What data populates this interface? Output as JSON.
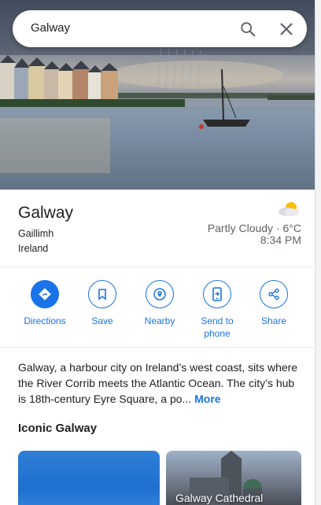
{
  "search": {
    "query": "Galway"
  },
  "place": {
    "name": "Galway",
    "irish_name": "Gaillimh",
    "country": "Ireland"
  },
  "weather": {
    "condition": "Partly Cloudy · 6°C",
    "time": "8:34 PM",
    "icon": "partly-cloudy-icon"
  },
  "actions": [
    {
      "label": "Directions",
      "icon": "directions-icon"
    },
    {
      "label": "Save",
      "icon": "bookmark-icon"
    },
    {
      "label": "Nearby",
      "icon": "nearby-icon"
    },
    {
      "label": "Send to phone",
      "icon": "send-to-phone-icon"
    },
    {
      "label": "Share",
      "icon": "share-icon"
    }
  ],
  "description": {
    "text": "Galway, a harbour city on Ireland’s west coast, sits where the River Corrib meets the Atlantic Ocean. The city’s hub is 18th-century Eyre Square, a po...",
    "more_label": "More"
  },
  "section": {
    "title": "Iconic Galway",
    "cards": [
      {
        "label": ""
      },
      {
        "label": "Galway Cathedral"
      }
    ]
  },
  "colors": {
    "accent": "#1a73e8",
    "text": "#202124",
    "secondary": "#5f6368"
  }
}
